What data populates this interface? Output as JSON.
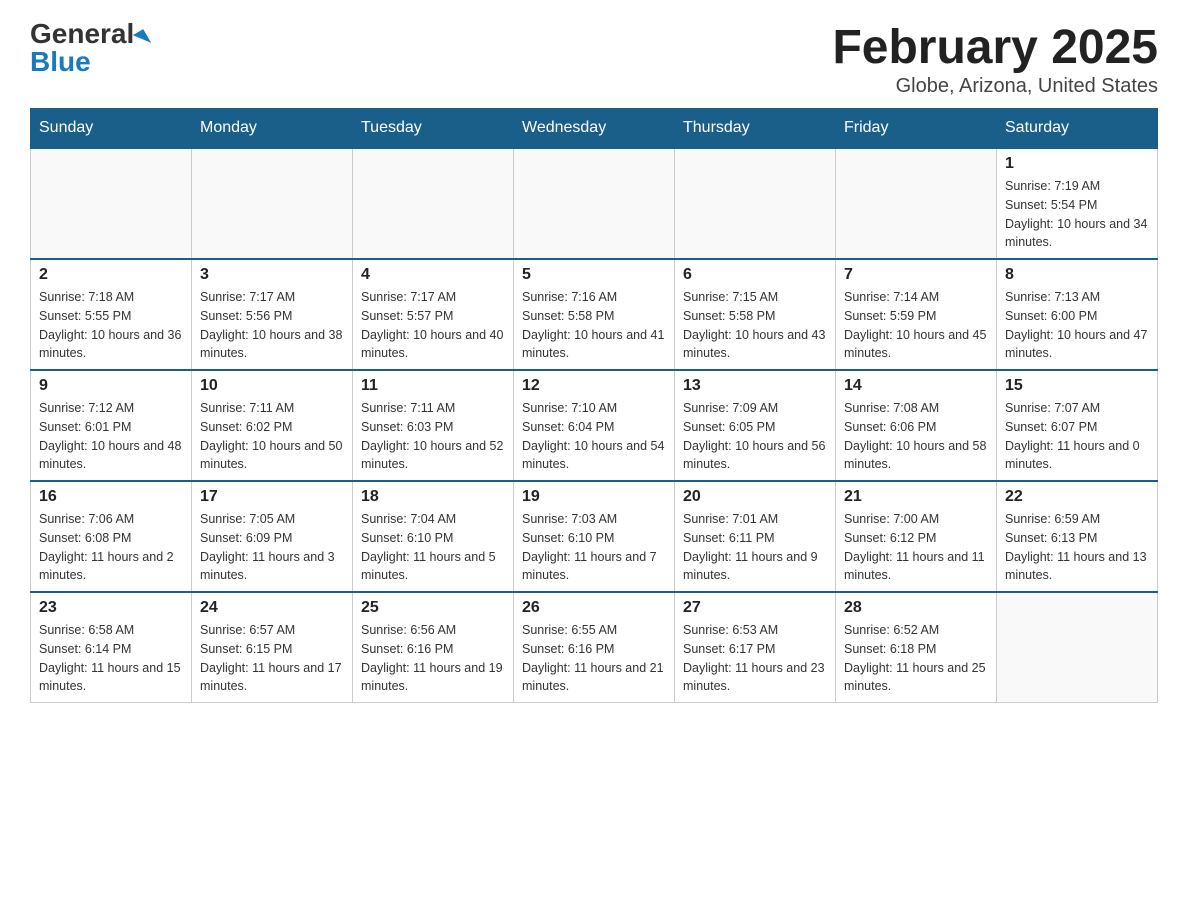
{
  "header": {
    "logo_general": "General",
    "logo_blue": "Blue",
    "title": "February 2025",
    "subtitle": "Globe, Arizona, United States"
  },
  "days_of_week": [
    "Sunday",
    "Monday",
    "Tuesday",
    "Wednesday",
    "Thursday",
    "Friday",
    "Saturday"
  ],
  "weeks": [
    [
      {
        "day": "",
        "info": ""
      },
      {
        "day": "",
        "info": ""
      },
      {
        "day": "",
        "info": ""
      },
      {
        "day": "",
        "info": ""
      },
      {
        "day": "",
        "info": ""
      },
      {
        "day": "",
        "info": ""
      },
      {
        "day": "1",
        "info": "Sunrise: 7:19 AM\nSunset: 5:54 PM\nDaylight: 10 hours and 34 minutes."
      }
    ],
    [
      {
        "day": "2",
        "info": "Sunrise: 7:18 AM\nSunset: 5:55 PM\nDaylight: 10 hours and 36 minutes."
      },
      {
        "day": "3",
        "info": "Sunrise: 7:17 AM\nSunset: 5:56 PM\nDaylight: 10 hours and 38 minutes."
      },
      {
        "day": "4",
        "info": "Sunrise: 7:17 AM\nSunset: 5:57 PM\nDaylight: 10 hours and 40 minutes."
      },
      {
        "day": "5",
        "info": "Sunrise: 7:16 AM\nSunset: 5:58 PM\nDaylight: 10 hours and 41 minutes."
      },
      {
        "day": "6",
        "info": "Sunrise: 7:15 AM\nSunset: 5:58 PM\nDaylight: 10 hours and 43 minutes."
      },
      {
        "day": "7",
        "info": "Sunrise: 7:14 AM\nSunset: 5:59 PM\nDaylight: 10 hours and 45 minutes."
      },
      {
        "day": "8",
        "info": "Sunrise: 7:13 AM\nSunset: 6:00 PM\nDaylight: 10 hours and 47 minutes."
      }
    ],
    [
      {
        "day": "9",
        "info": "Sunrise: 7:12 AM\nSunset: 6:01 PM\nDaylight: 10 hours and 48 minutes."
      },
      {
        "day": "10",
        "info": "Sunrise: 7:11 AM\nSunset: 6:02 PM\nDaylight: 10 hours and 50 minutes."
      },
      {
        "day": "11",
        "info": "Sunrise: 7:11 AM\nSunset: 6:03 PM\nDaylight: 10 hours and 52 minutes."
      },
      {
        "day": "12",
        "info": "Sunrise: 7:10 AM\nSunset: 6:04 PM\nDaylight: 10 hours and 54 minutes."
      },
      {
        "day": "13",
        "info": "Sunrise: 7:09 AM\nSunset: 6:05 PM\nDaylight: 10 hours and 56 minutes."
      },
      {
        "day": "14",
        "info": "Sunrise: 7:08 AM\nSunset: 6:06 PM\nDaylight: 10 hours and 58 minutes."
      },
      {
        "day": "15",
        "info": "Sunrise: 7:07 AM\nSunset: 6:07 PM\nDaylight: 11 hours and 0 minutes."
      }
    ],
    [
      {
        "day": "16",
        "info": "Sunrise: 7:06 AM\nSunset: 6:08 PM\nDaylight: 11 hours and 2 minutes."
      },
      {
        "day": "17",
        "info": "Sunrise: 7:05 AM\nSunset: 6:09 PM\nDaylight: 11 hours and 3 minutes."
      },
      {
        "day": "18",
        "info": "Sunrise: 7:04 AM\nSunset: 6:10 PM\nDaylight: 11 hours and 5 minutes."
      },
      {
        "day": "19",
        "info": "Sunrise: 7:03 AM\nSunset: 6:10 PM\nDaylight: 11 hours and 7 minutes."
      },
      {
        "day": "20",
        "info": "Sunrise: 7:01 AM\nSunset: 6:11 PM\nDaylight: 11 hours and 9 minutes."
      },
      {
        "day": "21",
        "info": "Sunrise: 7:00 AM\nSunset: 6:12 PM\nDaylight: 11 hours and 11 minutes."
      },
      {
        "day": "22",
        "info": "Sunrise: 6:59 AM\nSunset: 6:13 PM\nDaylight: 11 hours and 13 minutes."
      }
    ],
    [
      {
        "day": "23",
        "info": "Sunrise: 6:58 AM\nSunset: 6:14 PM\nDaylight: 11 hours and 15 minutes."
      },
      {
        "day": "24",
        "info": "Sunrise: 6:57 AM\nSunset: 6:15 PM\nDaylight: 11 hours and 17 minutes."
      },
      {
        "day": "25",
        "info": "Sunrise: 6:56 AM\nSunset: 6:16 PM\nDaylight: 11 hours and 19 minutes."
      },
      {
        "day": "26",
        "info": "Sunrise: 6:55 AM\nSunset: 6:16 PM\nDaylight: 11 hours and 21 minutes."
      },
      {
        "day": "27",
        "info": "Sunrise: 6:53 AM\nSunset: 6:17 PM\nDaylight: 11 hours and 23 minutes."
      },
      {
        "day": "28",
        "info": "Sunrise: 6:52 AM\nSunset: 6:18 PM\nDaylight: 11 hours and 25 minutes."
      },
      {
        "day": "",
        "info": ""
      }
    ]
  ]
}
